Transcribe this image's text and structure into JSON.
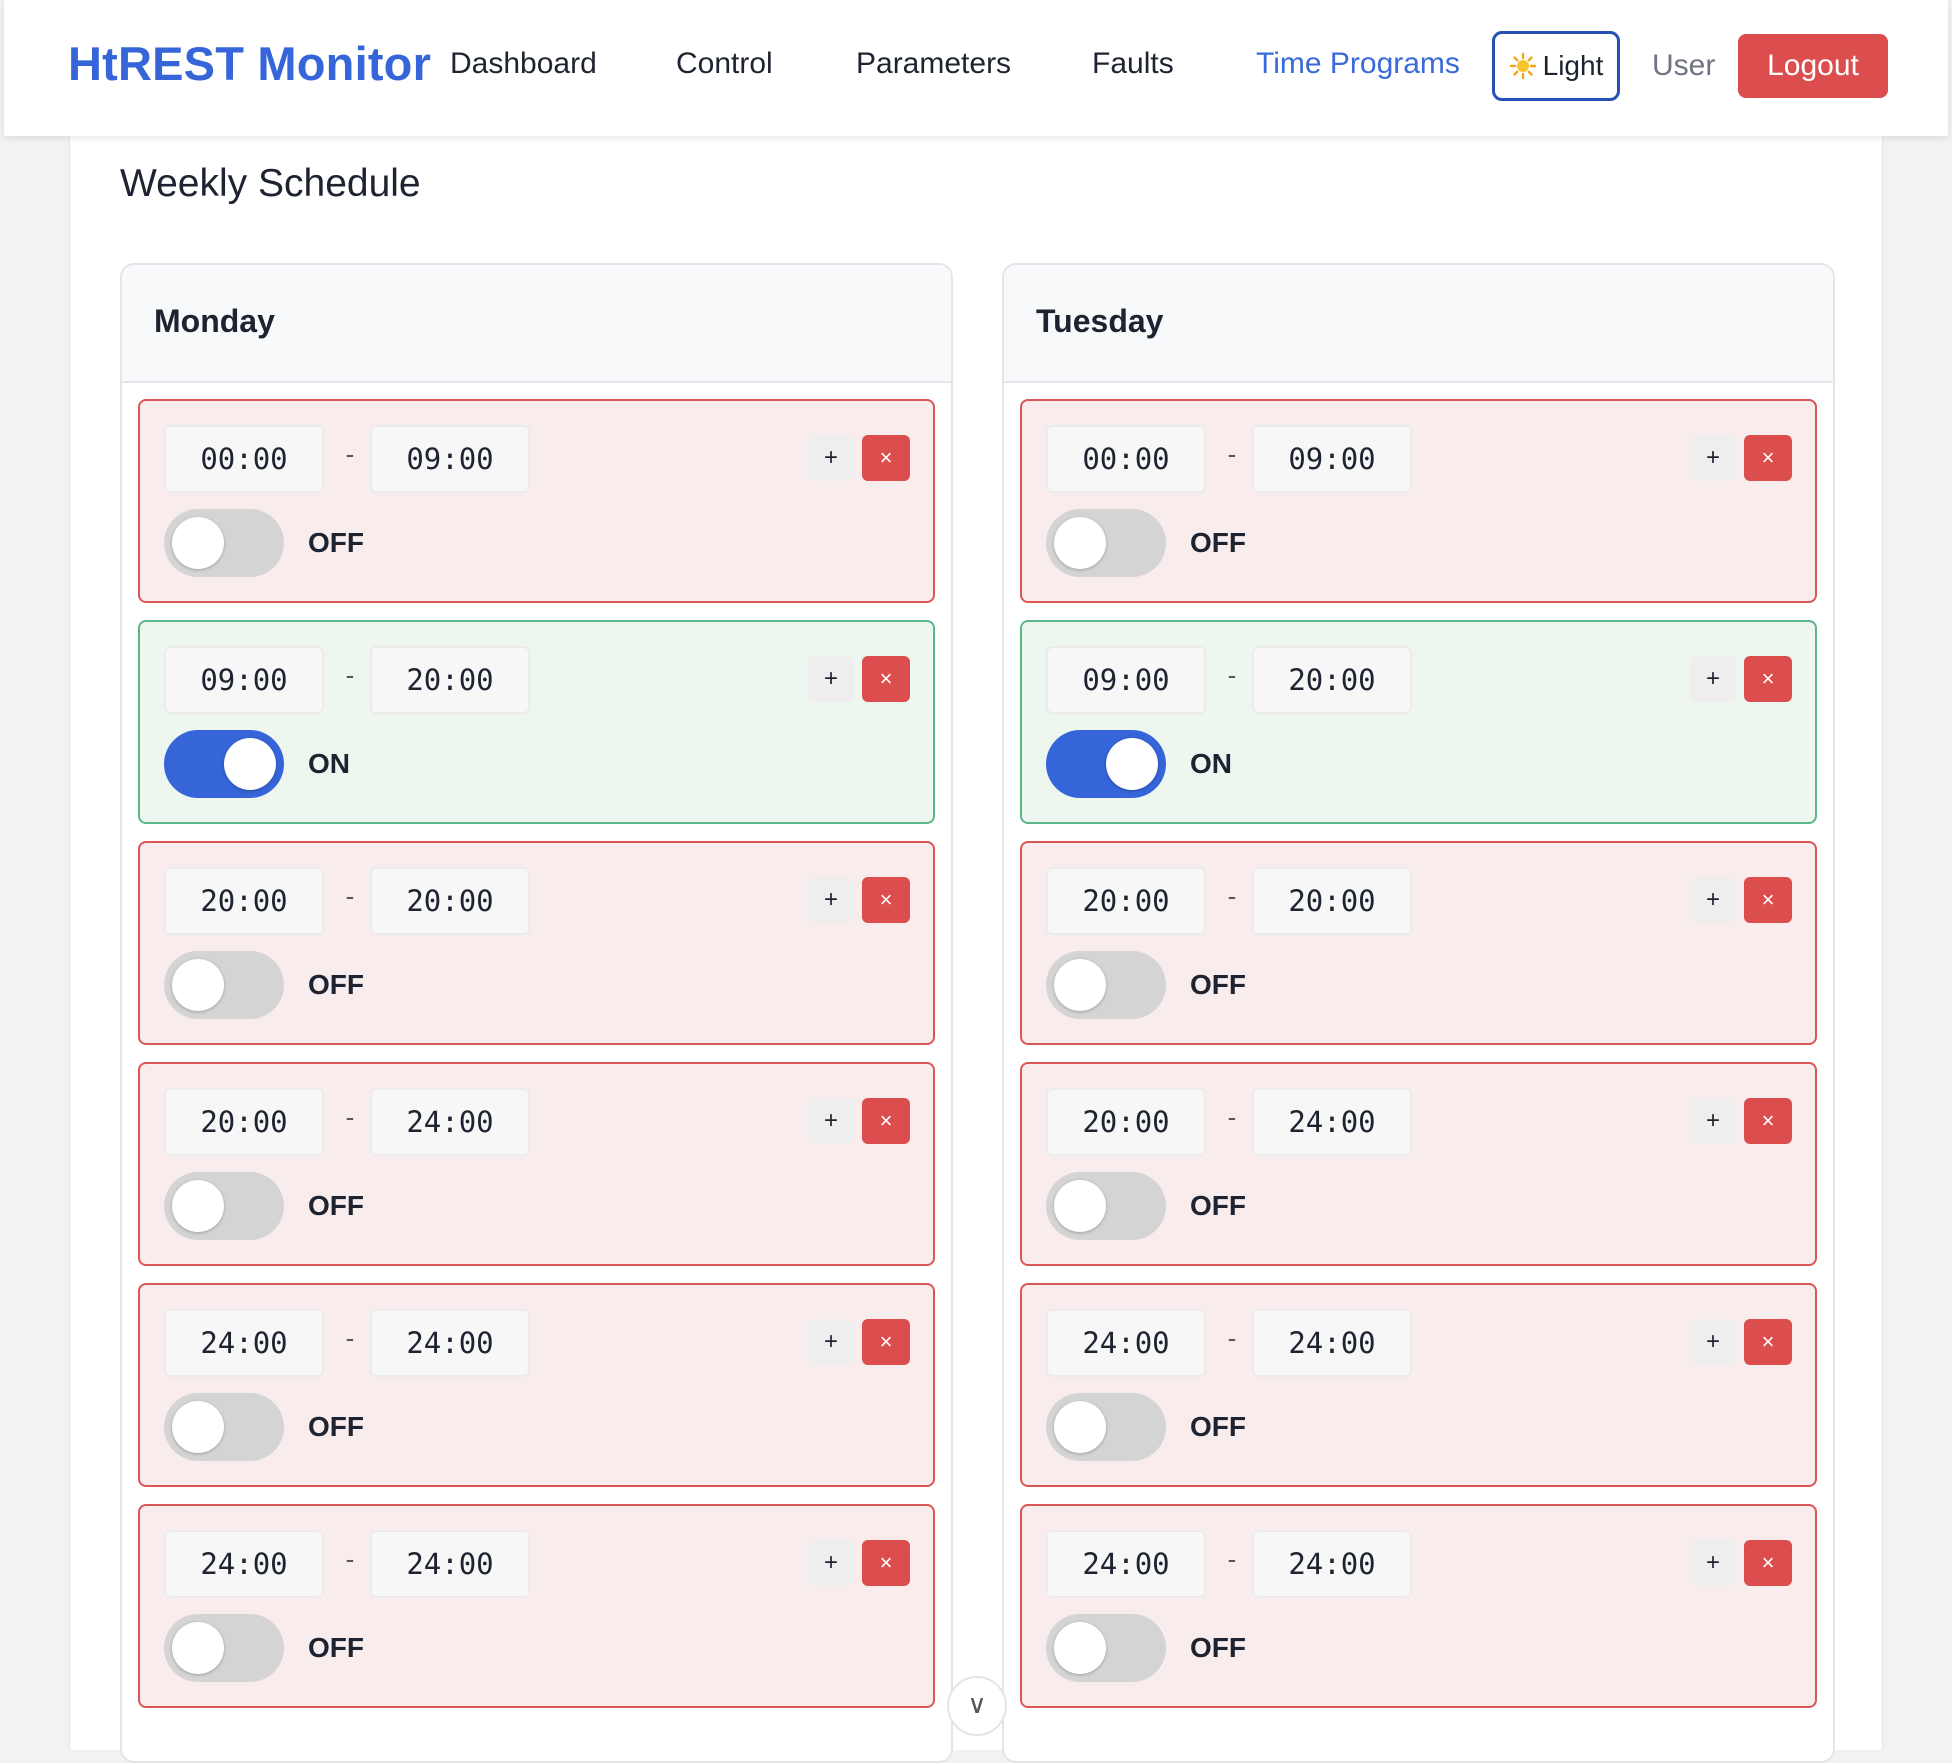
{
  "header": {
    "brand": "HtREST Monitor",
    "nav": [
      {
        "label": "Dashboard",
        "active": false
      },
      {
        "label": "Control",
        "active": false
      },
      {
        "label": "Parameters",
        "active": false
      },
      {
        "label": "Faults",
        "active": false
      },
      {
        "label": "Time Programs",
        "active": true
      }
    ],
    "theme_toggle_label": "Light",
    "theme_icon": "sun-icon",
    "user_label": "User",
    "logout_label": "Logout"
  },
  "main": {
    "title": "Weekly Schedule",
    "days": [
      {
        "name": "Monday",
        "slots": [
          {
            "start": "00:00",
            "end": "09:00",
            "on": false,
            "state": "OFF"
          },
          {
            "start": "09:00",
            "end": "20:00",
            "on": true,
            "state": "ON"
          },
          {
            "start": "20:00",
            "end": "20:00",
            "on": false,
            "state": "OFF"
          },
          {
            "start": "20:00",
            "end": "24:00",
            "on": false,
            "state": "OFF"
          },
          {
            "start": "24:00",
            "end": "24:00",
            "on": false,
            "state": "OFF"
          },
          {
            "start": "24:00",
            "end": "24:00",
            "on": false,
            "state": "OFF"
          }
        ]
      },
      {
        "name": "Tuesday",
        "slots": [
          {
            "start": "00:00",
            "end": "09:00",
            "on": false,
            "state": "OFF"
          },
          {
            "start": "09:00",
            "end": "20:00",
            "on": true,
            "state": "ON"
          },
          {
            "start": "20:00",
            "end": "20:00",
            "on": false,
            "state": "OFF"
          },
          {
            "start": "20:00",
            "end": "24:00",
            "on": false,
            "state": "OFF"
          },
          {
            "start": "24:00",
            "end": "24:00",
            "on": false,
            "state": "OFF"
          },
          {
            "start": "24:00",
            "end": "24:00",
            "on": false,
            "state": "OFF"
          }
        ]
      }
    ],
    "slot_controls": {
      "dash": "-",
      "add": "+",
      "remove": "×"
    },
    "scroll_glyph": "∨"
  },
  "colors": {
    "accent": "#3565d8",
    "danger": "#dc4e4e",
    "off_bg": "#f9eced",
    "on_bg": "#eef7ef",
    "on_border": "#5bb68a"
  }
}
